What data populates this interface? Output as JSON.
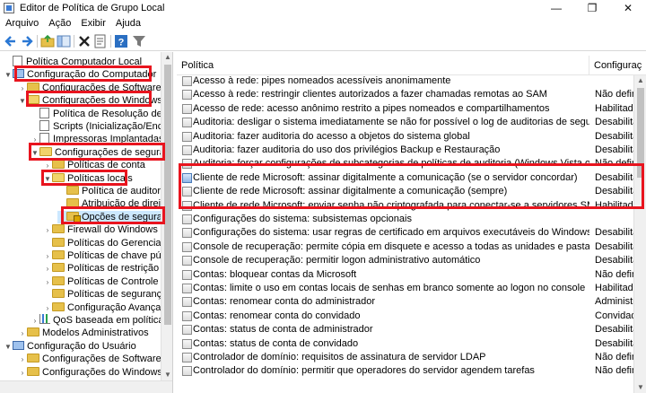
{
  "window": {
    "title": "Editor de Política de Grupo Local",
    "controls": [
      "—",
      "❐",
      "✕"
    ]
  },
  "menu": [
    "Arquivo",
    "Ação",
    "Exibir",
    "Ajuda"
  ],
  "toolbar": {
    "icons": [
      "back-arrow-icon",
      "forward-arrow-icon",
      "up-folder-icon",
      "show-tree-icon",
      "delete-icon",
      "properties-icon",
      "help-icon",
      "filter-icon"
    ]
  },
  "tree": [
    {
      "label": "Política Computador Local",
      "level": 0,
      "icon": "doc",
      "exp": ""
    },
    {
      "label": "Configuração do Computador",
      "level": 0,
      "icon": "pc",
      "exp": "▼"
    },
    {
      "label": "Configurações de Software",
      "level": 1,
      "icon": "folder",
      "exp": "›"
    },
    {
      "label": "Configurações do Windows",
      "level": 1,
      "icon": "folder-open",
      "exp": "▼"
    },
    {
      "label": "Política de Resolução de No",
      "level": 2,
      "icon": "doc",
      "exp": ""
    },
    {
      "label": "Scripts (Inicialização/Encerra",
      "level": 2,
      "icon": "doc",
      "exp": ""
    },
    {
      "label": "Impressoras Implantadas",
      "level": 2,
      "icon": "doc",
      "exp": "›"
    },
    {
      "label": "Configurações de segurança",
      "level": 2,
      "icon": "folder-open",
      "exp": "▼"
    },
    {
      "label": "Políticas de conta",
      "level": 3,
      "icon": "folder",
      "exp": "›"
    },
    {
      "label": "Políticas locais",
      "level": 3,
      "icon": "folder-open",
      "exp": "▼"
    },
    {
      "label": "Política de auditoria",
      "level": 4,
      "icon": "folder",
      "exp": ""
    },
    {
      "label": "Atribuição de direitos",
      "level": 4,
      "icon": "folder",
      "exp": ""
    },
    {
      "label": "Opções de segurança",
      "level": 4,
      "icon": "folder-lock",
      "exp": ""
    },
    {
      "label": "Firewall do Windows cor",
      "level": 3,
      "icon": "folder",
      "exp": "›"
    },
    {
      "label": "Políticas do Gerenciador",
      "level": 3,
      "icon": "folder",
      "exp": ""
    },
    {
      "label": "Políticas de chave públic",
      "level": 3,
      "icon": "folder",
      "exp": "›"
    },
    {
      "label": "Políticas de restrição de s",
      "level": 3,
      "icon": "folder",
      "exp": "›"
    },
    {
      "label": "Políticas de Controle de",
      "level": 3,
      "icon": "folder",
      "exp": "›"
    },
    {
      "label": "Políticas de segurança IP",
      "level": 3,
      "icon": "folder",
      "exp": ""
    },
    {
      "label": "Configuração Avançada",
      "level": 3,
      "icon": "folder",
      "exp": "›"
    },
    {
      "label": "QoS baseada em política",
      "level": 2,
      "icon": "chart",
      "exp": "›"
    },
    {
      "label": "Modelos Administrativos",
      "level": 1,
      "icon": "folder",
      "exp": "›"
    },
    {
      "label": "Configuração do Usuário",
      "level": 0,
      "icon": "pc",
      "exp": "▼"
    },
    {
      "label": "Configurações de Software",
      "level": 1,
      "icon": "folder",
      "exp": "›"
    },
    {
      "label": "Configurações do Windows",
      "level": 1,
      "icon": "folder",
      "exp": "›"
    }
  ],
  "columns": {
    "policy": "Política",
    "setting": "Configuraç"
  },
  "rows": [
    {
      "policy": "Acesso à rede: pipes nomeados acessíveis anonimamente",
      "setting": "",
      "blue": false
    },
    {
      "policy": "Acesso à rede: restringir clientes autorizados a fazer chamadas remotas ao SAM",
      "setting": "Não definid",
      "blue": false
    },
    {
      "policy": "Acesso de rede: acesso anônimo restrito a pipes nomeados e compartilhamentos",
      "setting": "Habilitada",
      "blue": false
    },
    {
      "policy": "Auditoria: desligar o sistema imediatamente se não for possível o log de auditorias de segurança",
      "setting": "Desabilitad",
      "blue": false
    },
    {
      "policy": "Auditoria: fazer auditoria do acesso a objetos do sistema global",
      "setting": "Desabilitad",
      "blue": false
    },
    {
      "policy": "Auditoria: fazer auditoria do uso dos privilégios Backup e Restauração",
      "setting": "Desabilitad",
      "blue": false
    },
    {
      "policy": "Auditoria: forçar configurações de subcategorias de políticas de auditoria (Windows Vista ou superior) par",
      "setting": "Não definid",
      "blue": false
    },
    {
      "policy": "Cliente de rede Microsoft: assinar digitalmente a comunicação (se o servidor concordar)",
      "setting": "Desabilitad",
      "blue": true
    },
    {
      "policy": "Cliente de rede Microsoft: assinar digitalmente a comunicação (sempre)",
      "setting": "Desabilitad",
      "blue": false
    },
    {
      "policy": "Cliente de rede Microsoft: enviar senha não criptografada para conectar-se a servidores SMB de outro fabri",
      "setting": "Habilitada",
      "blue": false
    },
    {
      "policy": "Configurações do sistema: subsistemas opcionais",
      "setting": "",
      "blue": false
    },
    {
      "policy": "Configurações do sistema: usar regras de certificado em arquivos executáveis do Windows para políticas d",
      "setting": "Desabilitad",
      "blue": false
    },
    {
      "policy": "Console de recuperação: permite cópia em disquete e acesso a todas as unidades e pastas",
      "setting": "Desabilitad",
      "blue": false
    },
    {
      "policy": "Console de recuperação: permitir logon administrativo automático",
      "setting": "Desabilitad",
      "blue": false
    },
    {
      "policy": "Contas: bloquear contas da Microsoft",
      "setting": "Não definid",
      "blue": false
    },
    {
      "policy": "Contas: limite o uso em contas locais de senhas em branco somente ao logon no console",
      "setting": "Habilitada",
      "blue": false
    },
    {
      "policy": "Contas: renomear conta do administrador",
      "setting": "Administra",
      "blue": false
    },
    {
      "policy": "Contas: renomear conta do convidado",
      "setting": "Convidado",
      "blue": false
    },
    {
      "policy": "Contas: status de conta de administrador",
      "setting": "Desabilitad",
      "blue": false
    },
    {
      "policy": "Contas: status de conta de convidado",
      "setting": "Desabilitad",
      "blue": false
    },
    {
      "policy": "Controlador de domínio: requisitos de assinatura de servidor LDAP",
      "setting": "Não definid",
      "blue": false
    },
    {
      "policy": "Controlador do domínio: permitir que operadores do servidor agendem tarefas",
      "setting": "Não definid",
      "blue": false
    }
  ],
  "highlight_color": "#e8141e"
}
